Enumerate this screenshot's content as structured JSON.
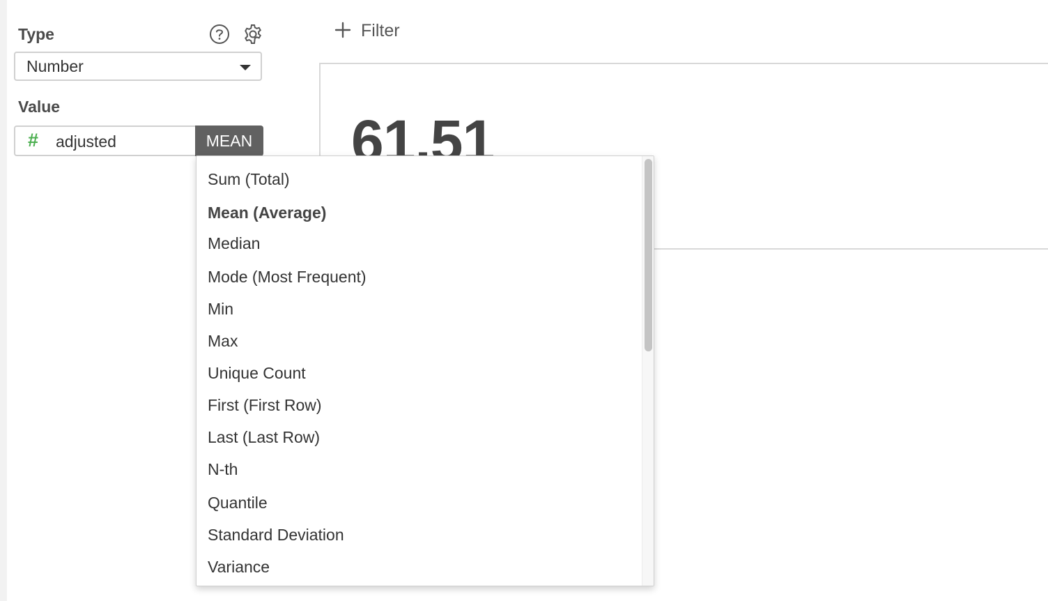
{
  "sidebar": {
    "type_label": "Type",
    "type_value": "Number",
    "value_label": "Value",
    "field_icon": "#",
    "field_name": "adjusted",
    "aggregation": "MEAN"
  },
  "toolbar": {
    "filter_label": "Filter"
  },
  "result": {
    "value": "61.51"
  },
  "dropdown": {
    "items": [
      "Sum (Total)",
      "Mean (Average)",
      "Median",
      "Mode (Most Frequent)",
      "Min",
      "Max",
      "Unique Count",
      "First (First Row)",
      "Last (Last Row)",
      "N-th",
      "Quantile",
      "Standard Deviation",
      "Variance"
    ],
    "selected": "Mean (Average)"
  },
  "colors": {
    "accent_green": "#4caf50",
    "button_dark": "#616161"
  }
}
